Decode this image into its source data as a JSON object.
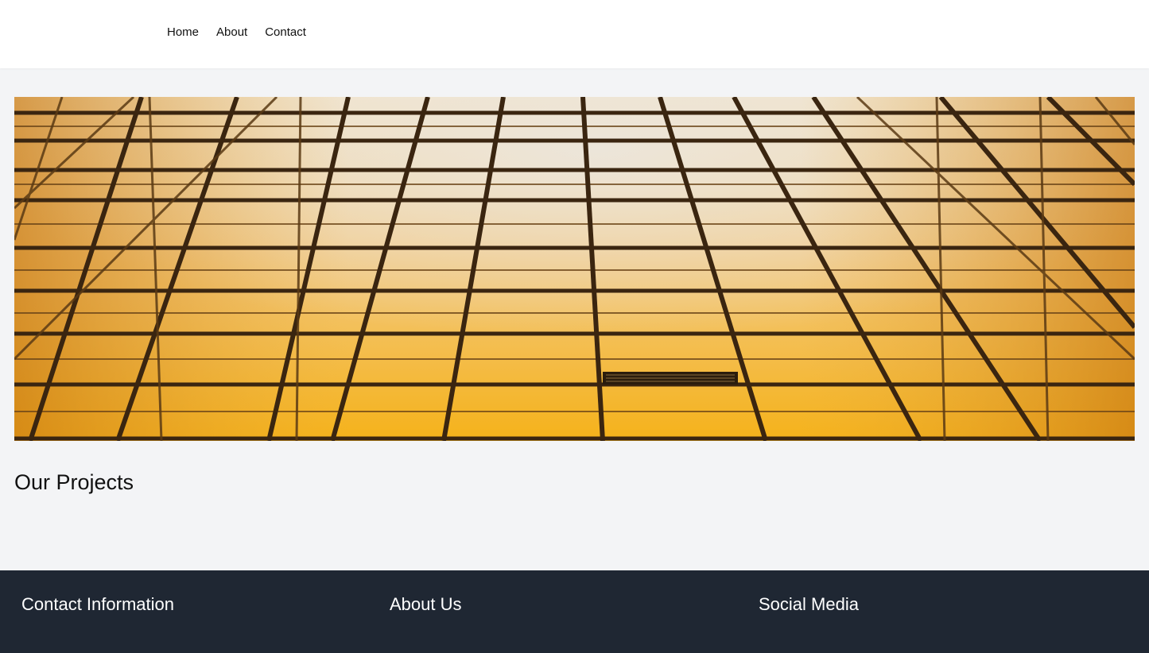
{
  "nav": {
    "items": [
      {
        "label": "Home"
      },
      {
        "label": "About"
      },
      {
        "label": "Contact"
      }
    ]
  },
  "hero": {
    "image": "glass-building-facade-photo"
  },
  "main": {
    "section_title": "Our Projects"
  },
  "footer": {
    "columns": [
      {
        "heading": "Contact Information"
      },
      {
        "heading": "About Us"
      },
      {
        "heading": "Social Media"
      }
    ],
    "background": "#1f2733"
  },
  "colors": {
    "page_background": "#f3f4f6",
    "navbar_background": "#ffffff",
    "hero_amber": "#f0a91c"
  }
}
